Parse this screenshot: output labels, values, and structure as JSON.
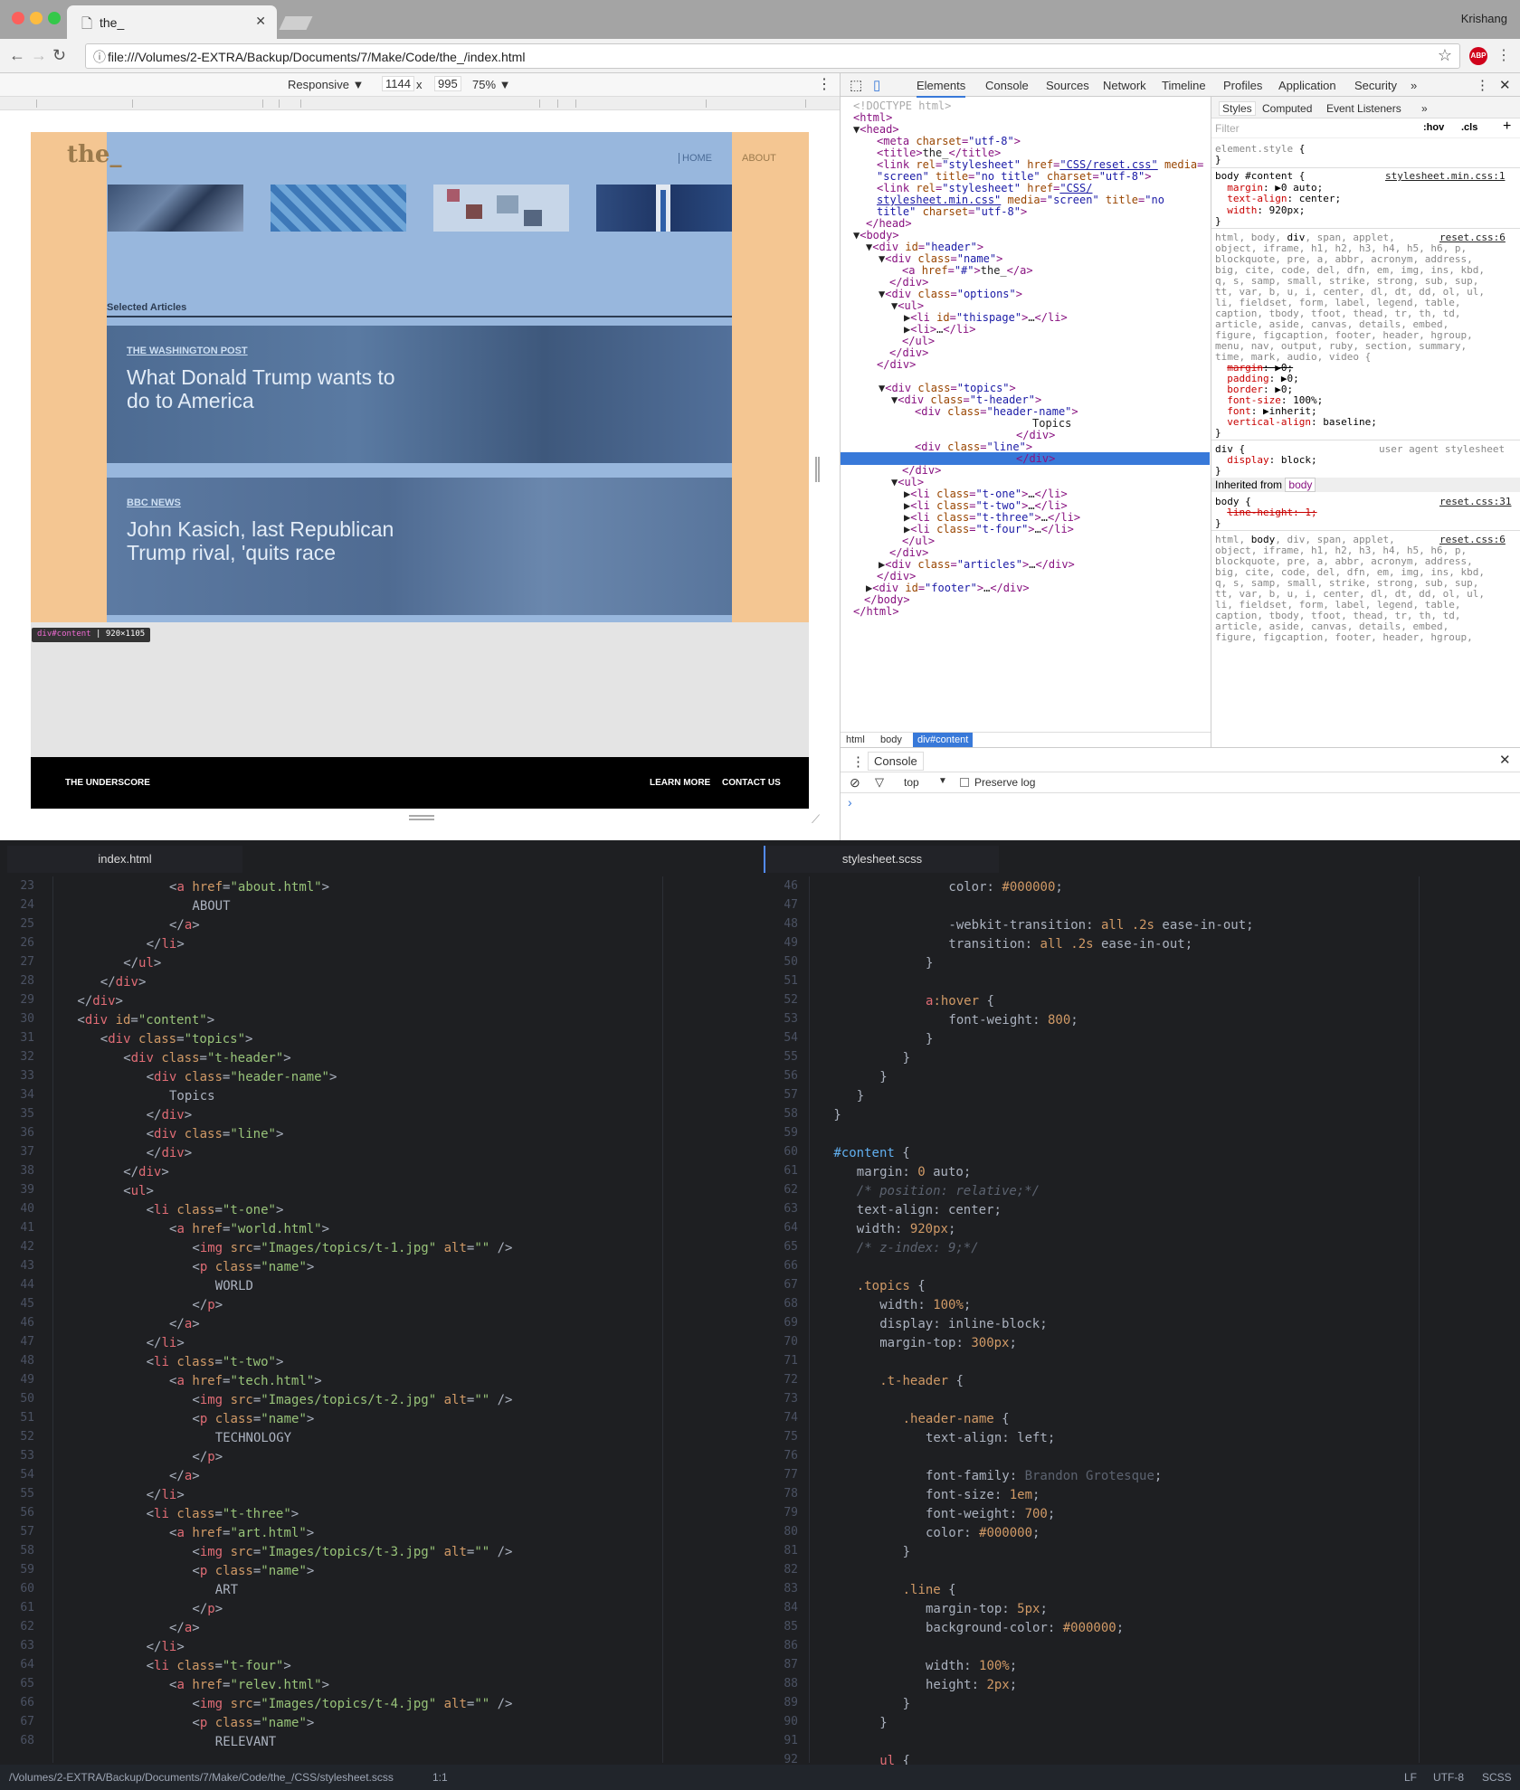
{
  "browser": {
    "tab_title": "the_",
    "user": "Krishang",
    "url": "file:///Volumes/2-EXTRA/Backup/Documents/7/Make/Code/the_/index.html",
    "abp": "ABP"
  },
  "device_bar": {
    "mode": "Responsive ▼",
    "width": "1144",
    "times": "x",
    "height": "995",
    "zoom": "75% ▼"
  },
  "site": {
    "logo": "the_",
    "nav_home": "HOME",
    "nav_about": "ABOUT",
    "selected": "Selected Articles",
    "articles": [
      {
        "source": "THE WASHINGTON POST",
        "headline": "What Donald Trump wants to do to America"
      },
      {
        "source": "BBC NEWS",
        "headline": "John Kasich, last Republican Trump rival, 'quits race"
      }
    ],
    "tooltip_sel": "div#content",
    "tooltip_size": "920×1105",
    "footer_left": "THE UNDERSCORE",
    "footer_learn": "LEARN MORE",
    "footer_contact": "CONTACT US"
  },
  "devtools": {
    "tabs": [
      "Elements",
      "Console",
      "Sources",
      "Network",
      "Timeline",
      "Profiles",
      "Application",
      "Security"
    ],
    "more": "»",
    "crumbs": [
      "html",
      "body",
      "div#content"
    ],
    "styles_tabs": [
      "Styles",
      "Computed",
      "Event Listeners"
    ],
    "filter": "Filter",
    "hov": ":hov",
    "cls": ".cls",
    "inherited": "Inherited from",
    "inherited_from": "body",
    "console_tab": "Console",
    "console_ctx": "top",
    "preserve": "Preserve log"
  },
  "editor": {
    "left_tab": "index.html",
    "right_tab": "stylesheet.scss",
    "status_path": "/Volumes/2-EXTRA/Backup/Documents/7/Make/Code/the_/CSS/stylesheet.scss",
    "status_pos": "1:1",
    "status_lf": "LF",
    "status_enc": "UTF-8",
    "status_lang": "SCSS"
  },
  "colors": {
    "accent": "#3879d9",
    "site_blue": "#98b7dd",
    "site_orange": "#f4c692"
  }
}
